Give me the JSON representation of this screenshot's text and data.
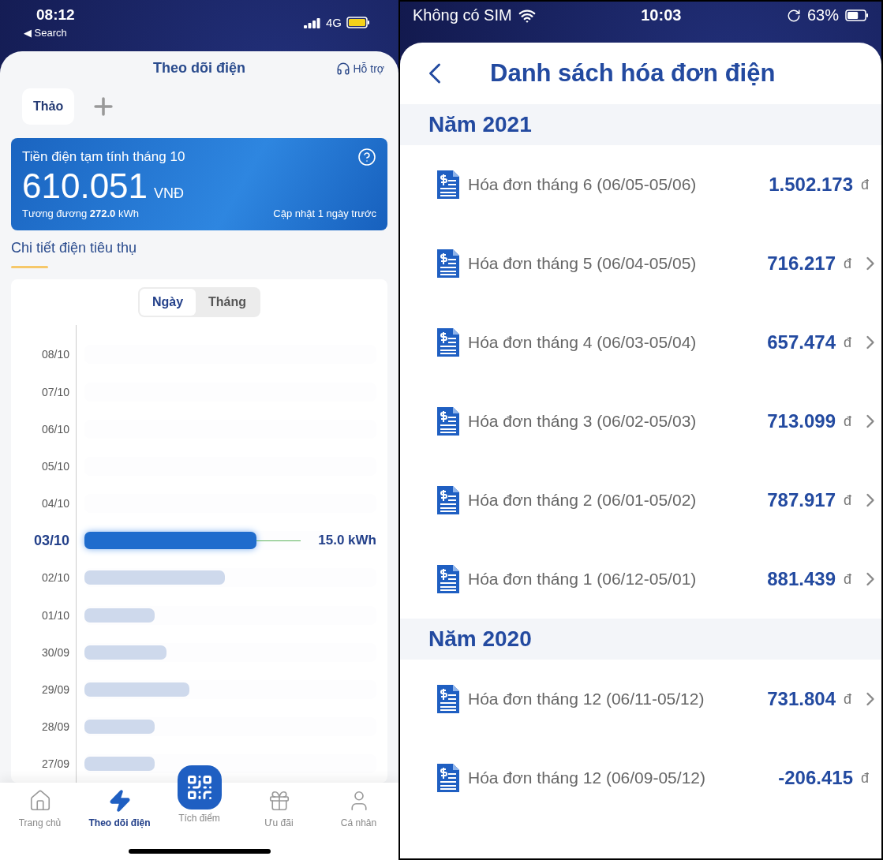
{
  "left_phone": {
    "status_bar": {
      "time": "08:12",
      "back_link": "◀ Search",
      "network": "4G"
    },
    "header": {
      "title": "Theo dõi điện",
      "support": "Hỗ trợ"
    },
    "accounts": [
      {
        "label": "Thảo"
      }
    ],
    "bill_card": {
      "title": "Tiền điện tạm tính tháng 10",
      "amount": "610.051",
      "currency": "VNĐ",
      "equivalent": "Tương đương **272.0** kWh",
      "updated": "Cập nhật 1 ngày trước"
    },
    "section_title": "Chi tiết điện tiêu thụ",
    "period_tabs": [
      {
        "label": "Ngày",
        "selected": true
      },
      {
        "label": "Tháng",
        "selected": false
      }
    ],
    "usage_rows": [
      {
        "date": "08/10",
        "selected": false
      },
      {
        "date": "07/10",
        "selected": false
      },
      {
        "date": "06/10",
        "selected": false
      },
      {
        "date": "05/10",
        "selected": false
      },
      {
        "date": "04/10",
        "selected": false
      },
      {
        "date": "03/10",
        "level": 0.59,
        "selected": true,
        "value": "15.0 kWh"
      },
      {
        "date": "02/10",
        "level": 0.48,
        "selected": false
      },
      {
        "date": "01/10",
        "level": 0.24,
        "selected": false
      },
      {
        "date": "30/09",
        "level": 0.28,
        "selected": false
      },
      {
        "date": "29/09",
        "level": 0.36,
        "selected": false
      },
      {
        "date": "28/09",
        "level": 0.24,
        "selected": false
      },
      {
        "date": "27/09",
        "level": 0.24,
        "selected": false
      }
    ],
    "bottom_nav": [
      {
        "kind": "home",
        "label": "Trang chủ",
        "selected": false
      },
      {
        "kind": "bolt",
        "label": "Theo dõi điện",
        "selected": true
      },
      {
        "kind": "qr",
        "label": "Tích điểm",
        "selected": false
      },
      {
        "kind": "gift",
        "label": "Ưu đãi",
        "selected": false
      },
      {
        "kind": "user",
        "label": "Cá nhân",
        "selected": false
      }
    ]
  },
  "right_phone": {
    "status_bar": {
      "carrier": "Không có SIM",
      "time": "10:03",
      "battery": "63%"
    },
    "header": {
      "title": "Danh sách hóa đơn điện"
    },
    "years": [
      {
        "label": "Năm 2021",
        "invoices": [
          {
            "label": "Hóa đơn tháng 6 (06/05-05/06)",
            "amount": "1.502.173",
            "currency": "đ",
            "chevron": false
          },
          {
            "label": "Hóa đơn tháng 5 (06/04-05/05)",
            "amount": "716.217",
            "currency": "đ",
            "chevron": true
          },
          {
            "label": "Hóa đơn tháng 4 (06/03-05/04)",
            "amount": "657.474",
            "currency": "đ",
            "chevron": true
          },
          {
            "label": "Hóa đơn tháng 3 (06/02-05/03)",
            "amount": "713.099",
            "currency": "đ",
            "chevron": true
          },
          {
            "label": "Hóa đơn tháng 2 (06/01-05/02)",
            "amount": "787.917",
            "currency": "đ",
            "chevron": true
          },
          {
            "label": "Hóa đơn tháng 1 (06/12-05/01)",
            "amount": "881.439",
            "currency": "đ",
            "chevron": true
          }
        ]
      },
      {
        "label": "Năm 2020",
        "invoices": [
          {
            "label": "Hóa đơn tháng 12 (06/11-05/12)",
            "amount": "731.804",
            "currency": "đ",
            "chevron": true
          },
          {
            "label": "Hóa đơn tháng 12 (06/09-05/12)",
            "amount": "-206.415",
            "currency": "đ",
            "chevron": false
          }
        ]
      }
    ]
  }
}
